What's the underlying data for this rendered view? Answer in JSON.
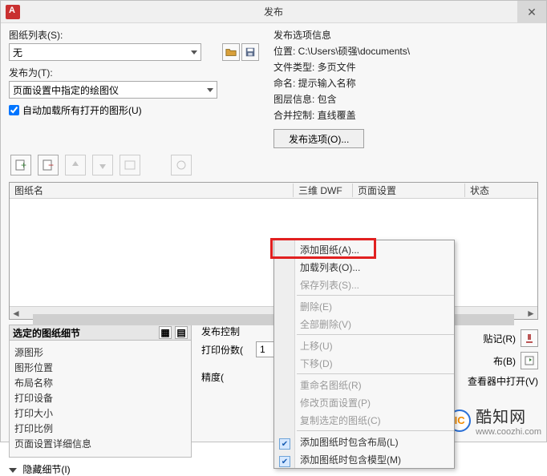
{
  "titlebar": {
    "title": "发布",
    "close": "✕"
  },
  "sheetList": {
    "label": "图纸列表(S):",
    "value": "无",
    "publishAsLabel": "发布为(T):",
    "publishAsValue": "页面设置中指定的绘图仪",
    "autoloadLabel": "自动加载所有打开的图形(U)"
  },
  "pubInfo": {
    "heading": "发布选项信息",
    "location": "位置: C:\\Users\\硕强\\documents\\",
    "fileType": "文件类型: 多页文件",
    "naming": "命名: 提示输入名称",
    "layerInfo": "图层信息: 包含",
    "merge": "合并控制: 直线覆盖",
    "optionsBtn": "发布选项(O)..."
  },
  "listHeaders": {
    "c1": "图纸名",
    "c2": "三维 DWF",
    "c3": "页面设置",
    "c4": "状态"
  },
  "details": {
    "title": "选定的图纸细节",
    "rows": [
      "源图形",
      "图形位置",
      "布局名称",
      "打印设备",
      "打印大小",
      "打印比例",
      "页面设置详细信息"
    ],
    "hide": "隐藏细节(I)"
  },
  "pubCtrl": {
    "heading": "发布控制",
    "copiesLabel": "打印份数(",
    "copiesValue": "1",
    "precisionLabel": "精度("
  },
  "rightBtns": {
    "r1": "贴记(R)",
    "r2": "布(B)",
    "r3": "查看器中打开(V)"
  },
  "context": {
    "addSheet": "添加图纸(A)...",
    "loadList": "加载列表(O)...",
    "saveList": "保存列表(S)...",
    "delete": "删除(E)",
    "deleteAll": "全部删除(V)",
    "moveUp": "上移(U)",
    "moveDown": "下移(D)",
    "rename": "重命名图纸(R)",
    "editPage": "修改页面设置(P)",
    "copySel": "复制选定的图纸(C)",
    "incLayout": "添加图纸时包含布局(L)",
    "incModel": "添加图纸时包含模型(M)"
  },
  "watermark": {
    "brand": "酷知网",
    "domain": "www.coozhi.com",
    "logo": "IC"
  }
}
